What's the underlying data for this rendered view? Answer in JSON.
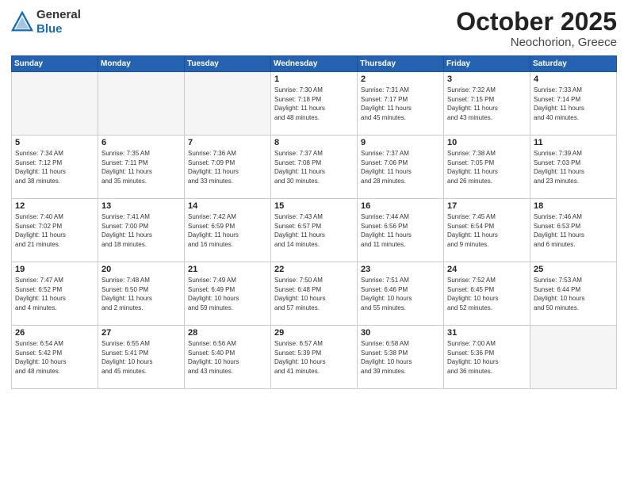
{
  "logo": {
    "general": "General",
    "blue": "Blue"
  },
  "title": "October 2025",
  "location": "Neochorion, Greece",
  "headers": [
    "Sunday",
    "Monday",
    "Tuesday",
    "Wednesday",
    "Thursday",
    "Friday",
    "Saturday"
  ],
  "weeks": [
    [
      {
        "day": "",
        "info": ""
      },
      {
        "day": "",
        "info": ""
      },
      {
        "day": "",
        "info": ""
      },
      {
        "day": "1",
        "info": "Sunrise: 7:30 AM\nSunset: 7:18 PM\nDaylight: 11 hours\nand 48 minutes."
      },
      {
        "day": "2",
        "info": "Sunrise: 7:31 AM\nSunset: 7:17 PM\nDaylight: 11 hours\nand 45 minutes."
      },
      {
        "day": "3",
        "info": "Sunrise: 7:32 AM\nSunset: 7:15 PM\nDaylight: 11 hours\nand 43 minutes."
      },
      {
        "day": "4",
        "info": "Sunrise: 7:33 AM\nSunset: 7:14 PM\nDaylight: 11 hours\nand 40 minutes."
      }
    ],
    [
      {
        "day": "5",
        "info": "Sunrise: 7:34 AM\nSunset: 7:12 PM\nDaylight: 11 hours\nand 38 minutes."
      },
      {
        "day": "6",
        "info": "Sunrise: 7:35 AM\nSunset: 7:11 PM\nDaylight: 11 hours\nand 35 minutes."
      },
      {
        "day": "7",
        "info": "Sunrise: 7:36 AM\nSunset: 7:09 PM\nDaylight: 11 hours\nand 33 minutes."
      },
      {
        "day": "8",
        "info": "Sunrise: 7:37 AM\nSunset: 7:08 PM\nDaylight: 11 hours\nand 30 minutes."
      },
      {
        "day": "9",
        "info": "Sunrise: 7:37 AM\nSunset: 7:06 PM\nDaylight: 11 hours\nand 28 minutes."
      },
      {
        "day": "10",
        "info": "Sunrise: 7:38 AM\nSunset: 7:05 PM\nDaylight: 11 hours\nand 26 minutes."
      },
      {
        "day": "11",
        "info": "Sunrise: 7:39 AM\nSunset: 7:03 PM\nDaylight: 11 hours\nand 23 minutes."
      }
    ],
    [
      {
        "day": "12",
        "info": "Sunrise: 7:40 AM\nSunset: 7:02 PM\nDaylight: 11 hours\nand 21 minutes."
      },
      {
        "day": "13",
        "info": "Sunrise: 7:41 AM\nSunset: 7:00 PM\nDaylight: 11 hours\nand 18 minutes."
      },
      {
        "day": "14",
        "info": "Sunrise: 7:42 AM\nSunset: 6:59 PM\nDaylight: 11 hours\nand 16 minutes."
      },
      {
        "day": "15",
        "info": "Sunrise: 7:43 AM\nSunset: 6:57 PM\nDaylight: 11 hours\nand 14 minutes."
      },
      {
        "day": "16",
        "info": "Sunrise: 7:44 AM\nSunset: 6:56 PM\nDaylight: 11 hours\nand 11 minutes."
      },
      {
        "day": "17",
        "info": "Sunrise: 7:45 AM\nSunset: 6:54 PM\nDaylight: 11 hours\nand 9 minutes."
      },
      {
        "day": "18",
        "info": "Sunrise: 7:46 AM\nSunset: 6:53 PM\nDaylight: 11 hours\nand 6 minutes."
      }
    ],
    [
      {
        "day": "19",
        "info": "Sunrise: 7:47 AM\nSunset: 6:52 PM\nDaylight: 11 hours\nand 4 minutes."
      },
      {
        "day": "20",
        "info": "Sunrise: 7:48 AM\nSunset: 6:50 PM\nDaylight: 11 hours\nand 2 minutes."
      },
      {
        "day": "21",
        "info": "Sunrise: 7:49 AM\nSunset: 6:49 PM\nDaylight: 10 hours\nand 59 minutes."
      },
      {
        "day": "22",
        "info": "Sunrise: 7:50 AM\nSunset: 6:48 PM\nDaylight: 10 hours\nand 57 minutes."
      },
      {
        "day": "23",
        "info": "Sunrise: 7:51 AM\nSunset: 6:46 PM\nDaylight: 10 hours\nand 55 minutes."
      },
      {
        "day": "24",
        "info": "Sunrise: 7:52 AM\nSunset: 6:45 PM\nDaylight: 10 hours\nand 52 minutes."
      },
      {
        "day": "25",
        "info": "Sunrise: 7:53 AM\nSunset: 6:44 PM\nDaylight: 10 hours\nand 50 minutes."
      }
    ],
    [
      {
        "day": "26",
        "info": "Sunrise: 6:54 AM\nSunset: 5:42 PM\nDaylight: 10 hours\nand 48 minutes."
      },
      {
        "day": "27",
        "info": "Sunrise: 6:55 AM\nSunset: 5:41 PM\nDaylight: 10 hours\nand 45 minutes."
      },
      {
        "day": "28",
        "info": "Sunrise: 6:56 AM\nSunset: 5:40 PM\nDaylight: 10 hours\nand 43 minutes."
      },
      {
        "day": "29",
        "info": "Sunrise: 6:57 AM\nSunset: 5:39 PM\nDaylight: 10 hours\nand 41 minutes."
      },
      {
        "day": "30",
        "info": "Sunrise: 6:58 AM\nSunset: 5:38 PM\nDaylight: 10 hours\nand 39 minutes."
      },
      {
        "day": "31",
        "info": "Sunrise: 7:00 AM\nSunset: 5:36 PM\nDaylight: 10 hours\nand 36 minutes."
      },
      {
        "day": "",
        "info": ""
      }
    ]
  ]
}
